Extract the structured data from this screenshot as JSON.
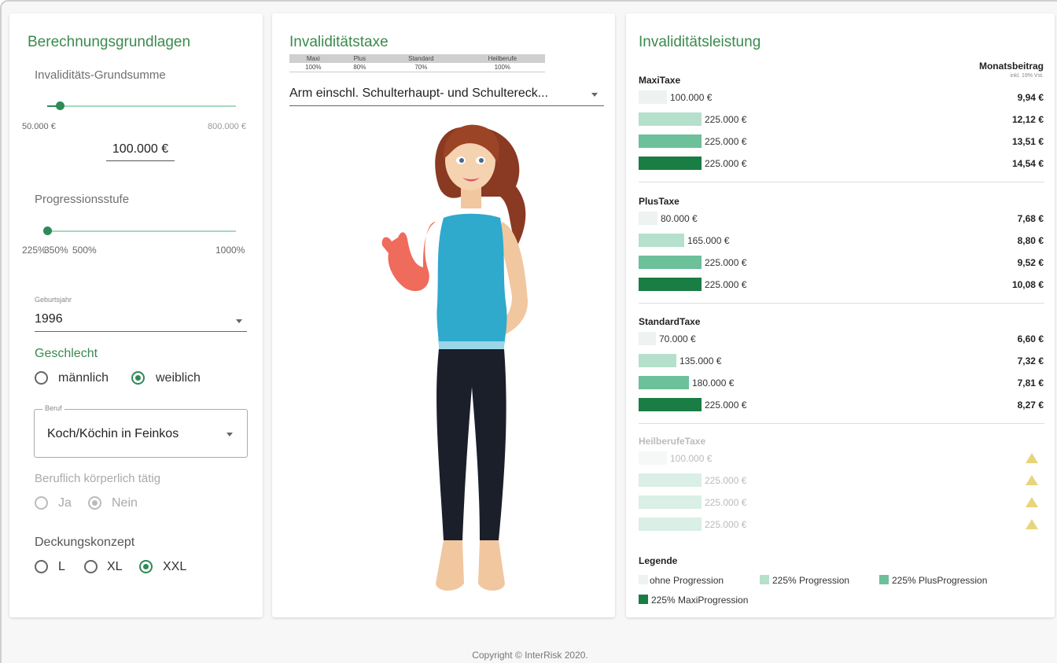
{
  "colors": {
    "accent": "#2e8a57",
    "title": "#3b8a4e",
    "bar_none": "#eef2f0",
    "bar_225": "#b5e0cc",
    "bar_plus": "#6cc09a",
    "bar_maxi": "#1a7d44"
  },
  "left": {
    "title": "Berechnungsgrundlagen",
    "grundsumme": {
      "label": "Invaliditäts-Grundsumme",
      "min": "50.000 €",
      "max": "800.000 €",
      "value": "100.000 €",
      "fraction": 0.07
    },
    "progression": {
      "label": "Progressionsstufe",
      "tick1": "225%",
      "tick2": "350%",
      "tick3": "500%",
      "tick4": "1000%",
      "fraction": 0.0
    },
    "geburtsjahr": {
      "label": "Geburtsjahr",
      "value": "1996"
    },
    "geschlecht": {
      "label": "Geschlecht",
      "opt1": "männlich",
      "opt2": "weiblich",
      "selected": "weiblich"
    },
    "beruf": {
      "label": "Beruf",
      "value": "Koch/Köchin in Feinkos"
    },
    "koerperlich": {
      "label": "Beruflich körperlich tätig",
      "opt1": "Ja",
      "opt2": "Nein",
      "selected": "Nein"
    },
    "deckung": {
      "label": "Deckungskonzept",
      "opt1": "L",
      "opt2": "XL",
      "opt3": "XXL",
      "selected": "XXL"
    }
  },
  "middle": {
    "title": "Invaliditätstaxe",
    "table": {
      "headers": [
        "Maxi",
        "Plus",
        "Standard",
        "Heilberufe"
      ],
      "values": [
        "100%",
        "80%",
        "70%",
        "100%"
      ]
    },
    "select": "Arm einschl. Schulterhaupt- und Schultereck..."
  },
  "right": {
    "title": "Invaliditätsleistung",
    "beitrag_header": "Monatsbeitrag",
    "beitrag_sub": "inkl. 19% Vst.",
    "sections": [
      {
        "name": "MaxiTaxe",
        "rows": [
          {
            "amount": "100.000 €",
            "price": "9,94 €",
            "bar": "none",
            "len": 0.45
          },
          {
            "amount": "225.000 €",
            "price": "12,12 €",
            "bar": "p225",
            "len": 1.0
          },
          {
            "amount": "225.000 €",
            "price": "13,51 €",
            "bar": "plus",
            "len": 1.0
          },
          {
            "amount": "225.000 €",
            "price": "14,54 €",
            "bar": "maxi",
            "len": 1.0
          }
        ]
      },
      {
        "name": "PlusTaxe",
        "rows": [
          {
            "amount": "80.000 €",
            "price": "7,68 €",
            "bar": "none",
            "len": 0.3
          },
          {
            "amount": "165.000 €",
            "price": "8,80 €",
            "bar": "p225",
            "len": 0.73
          },
          {
            "amount": "225.000 €",
            "price": "9,52 €",
            "bar": "plus",
            "len": 1.0
          },
          {
            "amount": "225.000 €",
            "price": "10,08 €",
            "bar": "maxi",
            "len": 1.0
          }
        ]
      },
      {
        "name": "StandardTaxe",
        "rows": [
          {
            "amount": "70.000 €",
            "price": "6,60 €",
            "bar": "none",
            "len": 0.27
          },
          {
            "amount": "135.000 €",
            "price": "7,32 €",
            "bar": "p225",
            "len": 0.6
          },
          {
            "amount": "180.000 €",
            "price": "7,81 €",
            "bar": "plus",
            "len": 0.8
          },
          {
            "amount": "225.000 €",
            "price": "8,27 €",
            "bar": "maxi",
            "len": 1.0
          }
        ]
      },
      {
        "name": "HeilberufeTaxe",
        "disabled": true,
        "rows": [
          {
            "amount": "100.000 €",
            "price": "",
            "bar": "none",
            "len": 0.45
          },
          {
            "amount": "225.000 €",
            "price": "",
            "bar": "p225",
            "len": 1.0
          },
          {
            "amount": "225.000 €",
            "price": "",
            "bar": "p225",
            "len": 1.0
          },
          {
            "amount": "225.000 €",
            "price": "",
            "bar": "p225",
            "len": 1.0
          }
        ]
      }
    ],
    "legend": {
      "title": "Legende",
      "items": [
        "ohne Progression",
        "225% Progression",
        "225% PlusProgression",
        "225% MaxiProgression"
      ]
    }
  },
  "footer": {
    "copyright": "Copyright © InterRisk 2020."
  }
}
